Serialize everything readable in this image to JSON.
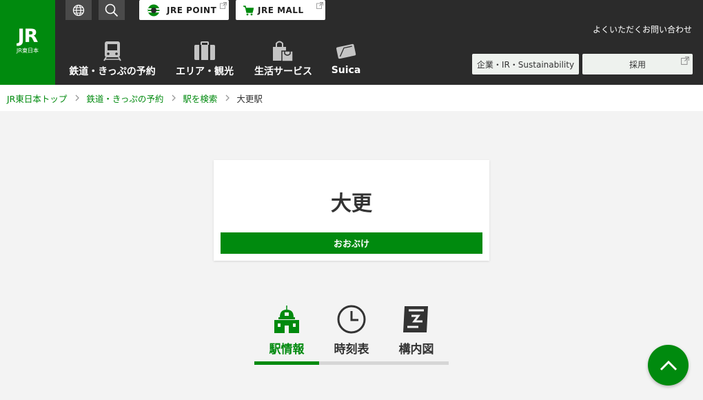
{
  "brand": {
    "logo_mark": "JR",
    "logo_sub": "JR東日本"
  },
  "top_links": {
    "jre_point": "JRE POINT",
    "jre_mall": "JRE MALL"
  },
  "nav": [
    {
      "label": "鉄道・きっぷの予約",
      "icon": "train-icon"
    },
    {
      "label": "エリア・観光",
      "icon": "suitcase-icon"
    },
    {
      "label": "生活サービス",
      "icon": "shopping-bag-icon"
    },
    {
      "label": "Suica",
      "icon": "suica-card-icon"
    }
  ],
  "header": {
    "contact": "よくいただくお問い合わせ",
    "corporate_button": "企業・IR・Sustainability",
    "recruit_button": "採用"
  },
  "breadcrumb": {
    "items": [
      "JR東日本トップ",
      "鉄道・きっぷの予約",
      "駅を検索"
    ],
    "current": "大更駅"
  },
  "station": {
    "name": "大更",
    "reading": "おおぶけ"
  },
  "tabs": [
    {
      "label": "駅情報",
      "icon": "station-building-icon",
      "active": true
    },
    {
      "label": "時刻表",
      "icon": "clock-icon",
      "active": false
    },
    {
      "label": "構内図",
      "icon": "station-map-icon",
      "active": false
    }
  ],
  "colors": {
    "brand_green": "#008a0e",
    "header_dark": "#2b2b2b",
    "page_bg": "#f3f3f3",
    "tab_inactive": "#d6d6d6"
  }
}
